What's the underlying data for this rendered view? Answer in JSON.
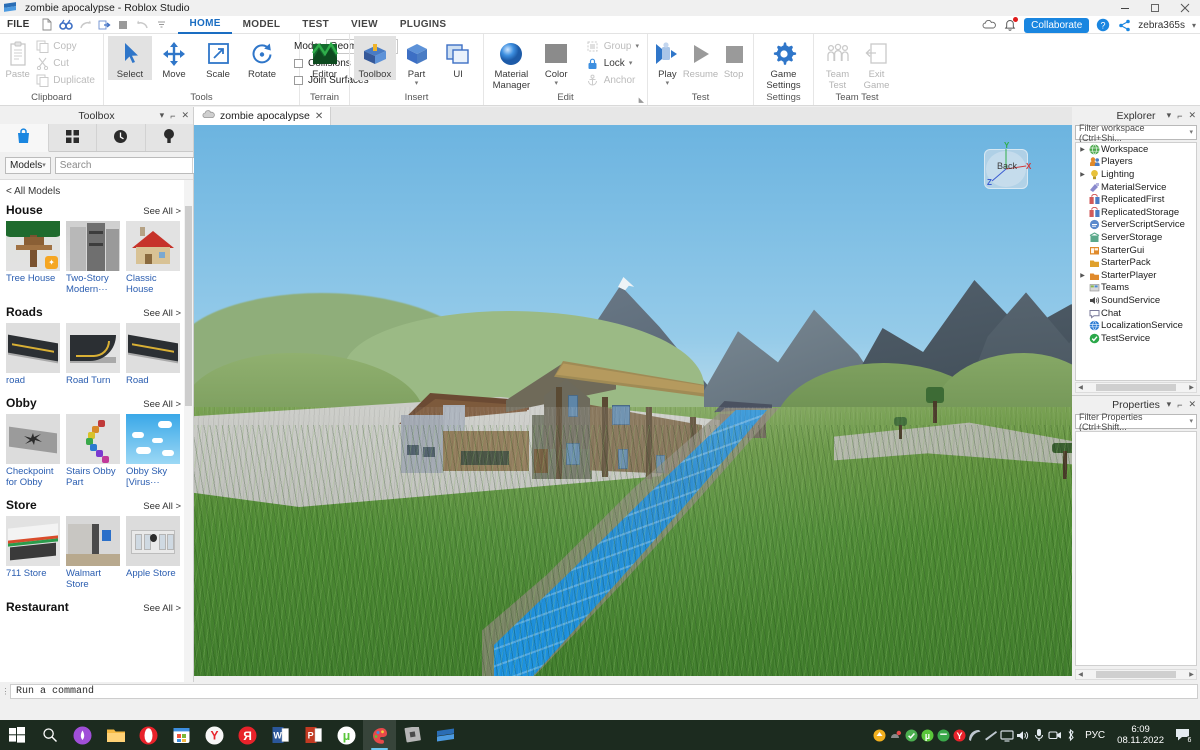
{
  "window": {
    "title": "zombie apocalypse - Roblox Studio",
    "minimize": "—",
    "maximize": "❐",
    "close": "✕"
  },
  "menu": {
    "file": "FILE",
    "quick_access": [
      {
        "name": "new-file-icon",
        "glyph": "page"
      },
      {
        "name": "find-icon",
        "glyph": "binoculars"
      },
      {
        "name": "redo-icon",
        "glyph": "redo"
      },
      {
        "name": "publish-icon",
        "glyph": "publish"
      },
      {
        "name": "stop-icon",
        "glyph": "square"
      },
      {
        "name": "undo-icon",
        "glyph": "undo"
      },
      {
        "name": "customize-qat-icon",
        "glyph": "caret"
      }
    ],
    "tabs": [
      {
        "label": "HOME",
        "active": true
      },
      {
        "label": "MODEL",
        "active": false
      },
      {
        "label": "TEST",
        "active": false
      },
      {
        "label": "VIEW",
        "active": false
      },
      {
        "label": "PLUGINS",
        "active": false
      }
    ]
  },
  "account_bar": {
    "cloud_icon": "cloud-icon",
    "notification_icon": "bell-icon",
    "collaborate": "Collaborate",
    "help_icon": "help-icon",
    "share_icon": "share-icon",
    "username": "zebra365s",
    "caret": "▾"
  },
  "ribbon": {
    "groups": [
      {
        "title": "Clipboard",
        "big": [
          {
            "label": "Paste",
            "icon": "paste-icon",
            "disabled": true
          }
        ],
        "small": [
          {
            "label": "Copy",
            "icon": "copy-icon",
            "disabled": true
          },
          {
            "label": "Cut",
            "icon": "cut-icon",
            "disabled": true
          },
          {
            "label": "Duplicate",
            "icon": "duplicate-icon",
            "disabled": true
          }
        ]
      },
      {
        "title": "Tools",
        "tools": [
          {
            "label": "Select",
            "icon": "cursor-icon",
            "selected": true
          },
          {
            "label": "Move",
            "icon": "move-arrows-icon",
            "selected": false
          },
          {
            "label": "Scale",
            "icon": "scale-icon",
            "selected": false
          },
          {
            "label": "Rotate",
            "icon": "rotate-icon",
            "selected": false
          }
        ],
        "mode_label": "Mode:",
        "mode_value": "Geometric",
        "checkboxes": [
          {
            "label": "Collisions",
            "checked": false
          },
          {
            "label": "Join Surfaces",
            "checked": false
          }
        ]
      },
      {
        "title": "Terrain",
        "big": [
          {
            "label": "Editor",
            "icon": "terrain-editor-icon",
            "disabled": false
          }
        ]
      },
      {
        "title": "Insert",
        "big": [
          {
            "label": "Toolbox",
            "icon": "toolbox-icon",
            "selected": true
          },
          {
            "label": "Part",
            "icon": "part-cube-icon",
            "dropdown": true
          },
          {
            "label": "UI",
            "icon": "ui-frame-icon"
          }
        ]
      },
      {
        "title": "Edit",
        "big": [
          {
            "label": "Material\nManager",
            "icon": "material-sphere-icon"
          },
          {
            "label": "Color",
            "icon": "color-swatch-icon",
            "dropdown": true
          }
        ],
        "small": [
          {
            "label": "Group",
            "icon": "group-icon",
            "disabled": true,
            "dropdown": true
          },
          {
            "label": "Lock",
            "icon": "lock-icon",
            "disabled": false,
            "dropdown": true
          },
          {
            "label": "Anchor",
            "icon": "anchor-icon",
            "disabled": true
          }
        ]
      },
      {
        "title": "Test",
        "big": [
          {
            "label": "Play",
            "icon": "play-icon",
            "dropdown": true
          },
          {
            "label": "Resume",
            "icon": "resume-triangle-icon",
            "disabled": true
          },
          {
            "label": "Stop",
            "icon": "stop-square-icon",
            "disabled": true
          }
        ]
      },
      {
        "title": "Settings",
        "big": [
          {
            "label": "Game\nSettings",
            "icon": "gear-icon"
          }
        ]
      },
      {
        "title": "Team Test",
        "big": [
          {
            "label": "Team\nTest",
            "icon": "team-people-icon",
            "disabled": true
          },
          {
            "label": "Exit\nGame",
            "icon": "exit-game-icon",
            "disabled": true
          }
        ]
      }
    ]
  },
  "toolbox": {
    "title": "Toolbox",
    "panel_buttons": [
      "▾",
      "⌐",
      "✕"
    ],
    "tabs": [
      {
        "name": "marketplace-tab",
        "icon": "shopping-bag-icon",
        "active": true
      },
      {
        "name": "inventory-tab",
        "icon": "grid-squares-icon",
        "active": false
      },
      {
        "name": "recent-tab",
        "icon": "clock-icon",
        "active": false
      },
      {
        "name": "creations-tab",
        "icon": "lightbulb-icon",
        "active": false
      }
    ],
    "category_select": "Models",
    "search_placeholder": "Search",
    "search_value": "",
    "search_icon": "magnifier-icon",
    "filter_icon": "sliders-icon",
    "breadcrumb": "< All Models",
    "see_all": "See All >",
    "sections": [
      {
        "name": "House",
        "items": [
          {
            "label": "Tree House",
            "art": "treehouse"
          },
          {
            "label": "Two-Story Modern···",
            "art": "modern"
          },
          {
            "label": "Classic House",
            "art": "classic"
          }
        ]
      },
      {
        "name": "Roads",
        "items": [
          {
            "label": "road",
            "art": "road"
          },
          {
            "label": "Road Turn",
            "art": "roadturn"
          },
          {
            "label": "Road",
            "art": "road"
          }
        ]
      },
      {
        "name": "Obby",
        "items": [
          {
            "label": "Checkpoint for Obby",
            "art": "checkpoint"
          },
          {
            "label": "Stairs Obby Part",
            "art": "stairs"
          },
          {
            "label": "Obby Sky [Virus···",
            "art": "sky"
          }
        ]
      },
      {
        "name": "Store",
        "items": [
          {
            "label": "711 Store",
            "art": "s711"
          },
          {
            "label": "Walmart Store",
            "art": "walmart"
          },
          {
            "label": "Apple Store",
            "art": "apple"
          }
        ]
      },
      {
        "name": "Restaurant",
        "items": []
      }
    ]
  },
  "viewport": {
    "tab_label": "zombie apocalypse",
    "tab_icon": "cloud-place-icon",
    "tab_close": "✕",
    "navcube": {
      "face_label": "Back",
      "axis_y": "Y",
      "axis_x": "X",
      "axis_z": "Z"
    }
  },
  "explorer": {
    "title": "Explorer",
    "panel_buttons": [
      "▾",
      "⌐",
      "✕"
    ],
    "filter_placeholder": "Filter workspace (Ctrl+Shi...",
    "filter_caret": "▾",
    "items": [
      {
        "label": "Workspace",
        "icon": "workspace-globe-icon",
        "expandable": true,
        "color": "#4aa84a"
      },
      {
        "label": "Players",
        "icon": "players-icon",
        "expandable": false,
        "color": "#e08a2b"
      },
      {
        "label": "Lighting",
        "icon": "lighting-bulb-icon",
        "expandable": true,
        "color": "#e8c13a"
      },
      {
        "label": "MaterialService",
        "icon": "material-service-icon",
        "expandable": false,
        "color": "#8a8acd"
      },
      {
        "label": "ReplicatedFirst",
        "icon": "replicated-first-icon",
        "expandable": false,
        "color": "#d05a5a"
      },
      {
        "label": "ReplicatedStorage",
        "icon": "replicated-storage-icon",
        "expandable": false,
        "color": "#d05a5a"
      },
      {
        "label": "ServerScriptService",
        "icon": "server-script-icon",
        "expandable": false,
        "color": "#5a8acd"
      },
      {
        "label": "ServerStorage",
        "icon": "server-storage-icon",
        "expandable": false,
        "color": "#5aa88a"
      },
      {
        "label": "StarterGui",
        "icon": "starter-gui-icon",
        "expandable": false,
        "color": "#e08a2b"
      },
      {
        "label": "StarterPack",
        "icon": "starter-pack-icon",
        "expandable": false,
        "color": "#e0a02b"
      },
      {
        "label": "StarterPlayer",
        "icon": "starter-player-icon",
        "expandable": true,
        "color": "#e08a2b"
      },
      {
        "label": "Teams",
        "icon": "teams-icon",
        "expandable": false,
        "color": "#8ab84a"
      },
      {
        "label": "SoundService",
        "icon": "sound-service-icon",
        "expandable": false,
        "color": "#4a4a4a"
      },
      {
        "label": "Chat",
        "icon": "chat-bubble-icon",
        "expandable": false,
        "color": "#7a7a9a"
      },
      {
        "label": "LocalizationService",
        "icon": "localization-globe-icon",
        "expandable": false,
        "color": "#2b7ad0"
      },
      {
        "label": "TestService",
        "icon": "test-service-icon",
        "expandable": false,
        "color": "#2ba84a"
      }
    ]
  },
  "properties": {
    "title": "Properties",
    "panel_buttons": [
      "▾",
      "⌐",
      "✕"
    ],
    "filter_placeholder": "Filter Properties (Ctrl+Shift...",
    "filter_caret": "▾"
  },
  "command_bar": {
    "placeholder": "Run a command",
    "value": "Run a command",
    "grip_icon": "drag-grip-icon"
  },
  "taskbar": {
    "start_icon": "windows-start-icon",
    "search_icon": "search-magnifier-icon",
    "apps": [
      {
        "name": "cortana-icon",
        "glyph": "circle"
      },
      {
        "name": "file-explorer-icon",
        "glyph": "folder"
      },
      {
        "name": "opera-browser-icon",
        "glyph": "O"
      },
      {
        "name": "microsoft-store-icon",
        "glyph": "store"
      },
      {
        "name": "yandex-browser-icon",
        "glyph": "Y"
      },
      {
        "name": "yandex-icon",
        "glyph": "Я"
      },
      {
        "name": "word-icon",
        "glyph": "W"
      },
      {
        "name": "powerpoint-icon",
        "glyph": "P"
      },
      {
        "name": "utorrent-icon",
        "glyph": "µ"
      },
      {
        "name": "paint-icon",
        "glyph": "paint"
      },
      {
        "name": "roblox-icon",
        "glyph": "roblox"
      },
      {
        "name": "roblox-studio-icon",
        "glyph": "studio"
      }
    ],
    "tray": [
      {
        "name": "update-icon"
      },
      {
        "name": "driver-icon"
      },
      {
        "name": "shield-check-icon"
      },
      {
        "name": "utorrent-tray-icon"
      },
      {
        "name": "avira-icon"
      },
      {
        "name": "yandex-tray-icon"
      },
      {
        "name": "dish-icon"
      },
      {
        "name": "wifi-icon"
      },
      {
        "name": "network-icon"
      },
      {
        "name": "volume-icon"
      },
      {
        "name": "microphone-icon"
      },
      {
        "name": "camera-icon"
      },
      {
        "name": "bluetooth-icon"
      }
    ],
    "language": "РУС",
    "time": "6:09",
    "date": "08.11.2022",
    "action_center_icon": "action-center-icon",
    "action_center_count": "6"
  }
}
